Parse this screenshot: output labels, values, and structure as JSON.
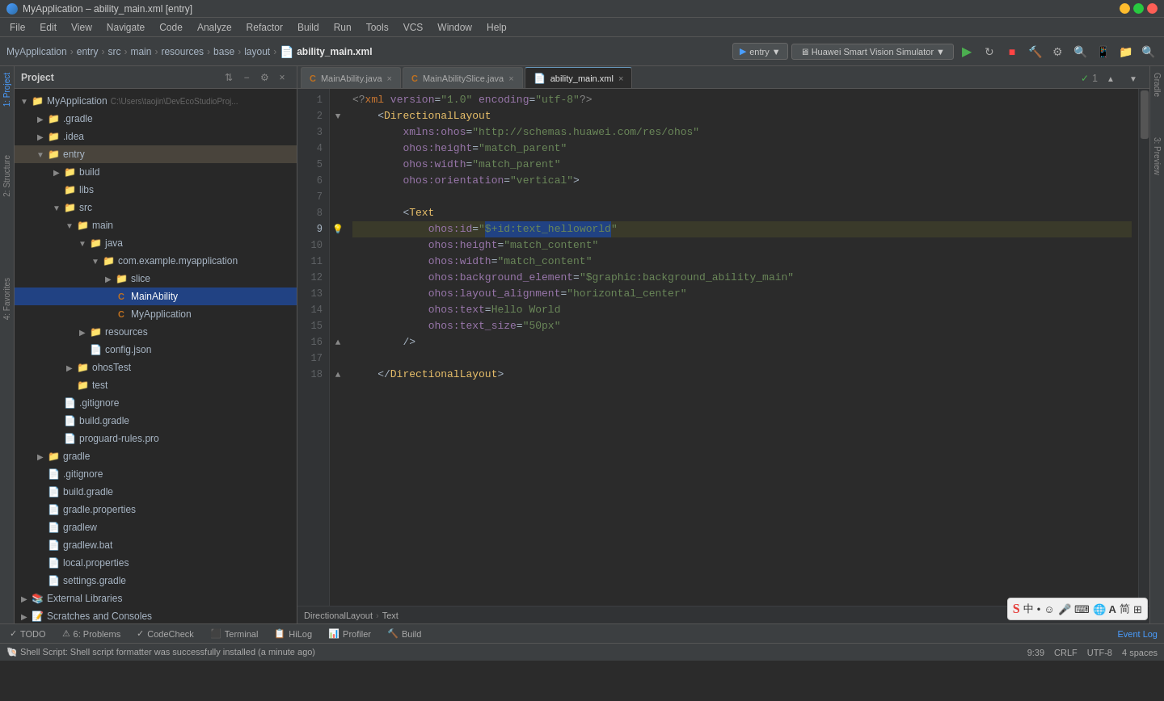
{
  "titleBar": {
    "title": "MyApplication – ability_main.xml [entry]",
    "appIcon": "●",
    "minimize": "−",
    "maximize": "□",
    "close": "×"
  },
  "menuBar": {
    "items": [
      "File",
      "Edit",
      "View",
      "Navigate",
      "Code",
      "Analyze",
      "Refactor",
      "Build",
      "Run",
      "Tools",
      "VCS",
      "Window",
      "Help"
    ]
  },
  "toolbar": {
    "breadcrumb": [
      "MyApplication",
      "entry",
      "src",
      "main",
      "resources",
      "base",
      "layout",
      "ability_main.xml"
    ],
    "entryBtn": "entry ▼",
    "simulatorBtn": "🖥 Huawei Smart Vision Simulator ▼",
    "runIcon": "▶",
    "rerunIcon": "↻",
    "stopIcon": "■",
    "buildIcon": "🔨",
    "searchIcon": "🔍"
  },
  "projectPanel": {
    "title": "Project",
    "tree": [
      {
        "level": 0,
        "label": "MyApplication",
        "type": "root",
        "path": "C:\\Users\\taojin\\DevEcoStudioProj...",
        "expanded": true
      },
      {
        "level": 1,
        "label": ".gradle",
        "type": "folder",
        "expanded": false
      },
      {
        "level": 1,
        "label": ".idea",
        "type": "folder",
        "expanded": false
      },
      {
        "level": 1,
        "label": "entry",
        "type": "folder-yellow",
        "expanded": true,
        "selected": false
      },
      {
        "level": 2,
        "label": "build",
        "type": "folder",
        "expanded": false
      },
      {
        "level": 2,
        "label": "libs",
        "type": "folder",
        "expanded": false
      },
      {
        "level": 2,
        "label": "src",
        "type": "folder",
        "expanded": true
      },
      {
        "level": 3,
        "label": "main",
        "type": "folder",
        "expanded": true
      },
      {
        "level": 4,
        "label": "java",
        "type": "folder",
        "expanded": true
      },
      {
        "level": 5,
        "label": "com.example.myapplication",
        "type": "folder",
        "expanded": true
      },
      {
        "level": 6,
        "label": "slice",
        "type": "folder",
        "expanded": false
      },
      {
        "level": 6,
        "label": "MainAbility",
        "type": "java",
        "selected": false
      },
      {
        "level": 6,
        "label": "MyApplication",
        "type": "java"
      },
      {
        "level": 4,
        "label": "resources",
        "type": "folder",
        "expanded": false
      },
      {
        "level": 4,
        "label": "config.json",
        "type": "config"
      },
      {
        "level": 3,
        "label": "ohosTest",
        "type": "folder",
        "expanded": false
      },
      {
        "level": 3,
        "label": "test",
        "type": "folder",
        "expanded": false
      },
      {
        "level": 2,
        "label": ".gitignore",
        "type": "file"
      },
      {
        "level": 2,
        "label": "build.gradle",
        "type": "gradle"
      },
      {
        "level": 2,
        "label": "proguard-rules.pro",
        "type": "file"
      },
      {
        "level": 1,
        "label": "gradle",
        "type": "folder",
        "expanded": false
      },
      {
        "level": 1,
        "label": ".gitignore",
        "type": "file"
      },
      {
        "level": 1,
        "label": "build.gradle",
        "type": "gradle"
      },
      {
        "level": 1,
        "label": "gradle.properties",
        "type": "gradle"
      },
      {
        "level": 1,
        "label": "gradlew",
        "type": "file"
      },
      {
        "level": 1,
        "label": "gradlew.bat",
        "type": "file"
      },
      {
        "level": 1,
        "label": "local.properties",
        "type": "file"
      },
      {
        "level": 1,
        "label": "settings.gradle",
        "type": "gradle"
      },
      {
        "level": 0,
        "label": "External Libraries",
        "type": "folder",
        "expanded": false
      },
      {
        "level": 0,
        "label": "Scratches and Consoles",
        "type": "scratch",
        "expanded": false
      }
    ]
  },
  "tabs": [
    {
      "label": "MainAbility.java",
      "icon": "java",
      "active": false,
      "closable": true
    },
    {
      "label": "MainAbilitySlice.java",
      "icon": "java",
      "active": false,
      "closable": true
    },
    {
      "label": "ability_main.xml",
      "icon": "xml",
      "active": true,
      "closable": true
    }
  ],
  "editor": {
    "language": "XML",
    "filename": "ability_main.xml",
    "lines": [
      {
        "num": 1,
        "content": "<?xml version=\"1.0\" encoding=\"utf-8\"?>",
        "type": "decl"
      },
      {
        "num": 2,
        "content": "    <DirectionalLayout",
        "type": "tag-open"
      },
      {
        "num": 3,
        "content": "        xmlns:ohos=\"http://schemas.huawei.com/res/ohos\"",
        "type": "attr"
      },
      {
        "num": 4,
        "content": "        ohos:height=\"match_parent\"",
        "type": "attr"
      },
      {
        "num": 5,
        "content": "        ohos:width=\"match_parent\"",
        "type": "attr"
      },
      {
        "num": 6,
        "content": "        ohos:orientation=\"vertical\">",
        "type": "attr-close"
      },
      {
        "num": 7,
        "content": "",
        "type": "empty"
      },
      {
        "num": 8,
        "content": "        <Text",
        "type": "tag-open"
      },
      {
        "num": 9,
        "content": "            ohos:id=\"$+id:text_helloworld\"",
        "type": "attr-highlight"
      },
      {
        "num": 10,
        "content": "            ohos:height=\"match_content\"",
        "type": "attr"
      },
      {
        "num": 11,
        "content": "            ohos:width=\"match_content\"",
        "type": "attr"
      },
      {
        "num": 12,
        "content": "            ohos:background_element=\"$graphic:background_ability_main\"",
        "type": "attr"
      },
      {
        "num": 13,
        "content": "            ohos:layout_alignment=\"horizontal_center\"",
        "type": "attr"
      },
      {
        "num": 14,
        "content": "            ohos:text=Hello World",
        "type": "attr-text"
      },
      {
        "num": 15,
        "content": "            ohos:text_size=\"50px\"",
        "type": "attr"
      },
      {
        "num": 16,
        "content": "        />",
        "type": "close"
      },
      {
        "num": 17,
        "content": "",
        "type": "empty"
      },
      {
        "num": 18,
        "content": "    </DirectionalLayout>",
        "type": "tag-close"
      }
    ]
  },
  "editorBreadcrumb": {
    "items": [
      "DirectionalLayout",
      "Text"
    ]
  },
  "bottomTabs": [
    {
      "label": "TODO",
      "icon": "✓",
      "active": false
    },
    {
      "label": "6: Problems",
      "icon": "⚠",
      "active": false
    },
    {
      "label": "CodeCheck",
      "icon": "✓",
      "active": false
    },
    {
      "label": "Terminal",
      "icon": "⬛",
      "active": false
    },
    {
      "label": "HiLog",
      "icon": "📋",
      "active": false
    },
    {
      "label": "Profiler",
      "icon": "📊",
      "active": false
    },
    {
      "label": "Build",
      "icon": "🔨",
      "active": false
    }
  ],
  "statusBar": {
    "notification": "Shell Script: Shell script formatter was successfully installed (a minute ago)",
    "line": "9:39",
    "lineEnding": "CRLF",
    "encoding": "UTF-8",
    "indent": "4 spaces",
    "eventLog": "Event Log"
  },
  "rightPanels": [
    "Gradle",
    "3: Preview"
  ],
  "leftPanels": [
    "1: Project",
    "2: Structure",
    "4: Favorites"
  ],
  "checkmark": "✓ 1",
  "imeTools": [
    "S",
    "中",
    "•",
    "☺",
    "🎤",
    "⌨",
    "🌐",
    "A",
    "简",
    "⊞"
  ]
}
